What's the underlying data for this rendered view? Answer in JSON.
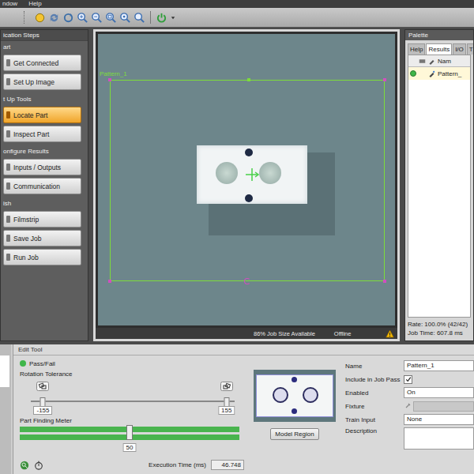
{
  "window": {
    "menu": [
      "ndow",
      "Help"
    ]
  },
  "steps_panel": {
    "title": "ication Steps",
    "groups": [
      {
        "label": "art",
        "items": [
          {
            "label": "Get Connected",
            "selected": false
          },
          {
            "label": "Set Up Image",
            "selected": false
          }
        ]
      },
      {
        "label": "t Up Tools",
        "items": [
          {
            "label": "Locate Part",
            "selected": true
          },
          {
            "label": "Inspect Part",
            "selected": false
          }
        ]
      },
      {
        "label": "onfigure Results",
        "items": [
          {
            "label": "Inputs / Outputs",
            "selected": false
          },
          {
            "label": "Communication",
            "selected": false
          }
        ]
      },
      {
        "label": "ish",
        "items": [
          {
            "label": "Filmstrip",
            "selected": false
          },
          {
            "label": "Save Job",
            "selected": false
          },
          {
            "label": "Run Job",
            "selected": false
          }
        ]
      }
    ]
  },
  "image_view": {
    "overlay_label": "Pattern_1",
    "job_size": "86% Job Size Available",
    "status": "Offline"
  },
  "palette": {
    "title": "Palette",
    "tabs": [
      {
        "label": "Help",
        "selected": false
      },
      {
        "label": "Results",
        "selected": true
      },
      {
        "label": "I/O",
        "selected": false
      },
      {
        "label": "T",
        "selected": false
      }
    ],
    "columns": [
      "Nam"
    ],
    "rows": [
      {
        "name": "Pattern_",
        "pass": true,
        "color": "#3fb64a"
      }
    ],
    "rate": "Rate: 100.0% (42/42)",
    "job_time": "Job Time: 607.8 ms"
  },
  "edit_tool": {
    "title": "Edit Tool",
    "status": "Pass/Fail",
    "status_pass": true,
    "rotation": {
      "label": "Rotation Tolerance",
      "min": "-155",
      "max": "155",
      "low": 0.06,
      "high": 0.96
    },
    "meter": {
      "label": "Part Finding Meter",
      "level": 1.0,
      "threshold": 0.5,
      "reading": "50"
    },
    "model_button": "Model Region",
    "fields": [
      {
        "label": "Name",
        "kind": "text",
        "value": "Pattern_1"
      },
      {
        "label": "Include in Job Pass",
        "kind": "checkbox",
        "checked": true
      },
      {
        "label": "Enabled",
        "kind": "select",
        "value": "On"
      },
      {
        "label": "Fixture",
        "kind": "fixture"
      },
      {
        "label": "Train Input",
        "kind": "select",
        "value": "None"
      },
      {
        "label": "Description",
        "kind": "textarea"
      }
    ],
    "execution_label": "Execution Time (ms)",
    "execution_time": "46.748"
  }
}
